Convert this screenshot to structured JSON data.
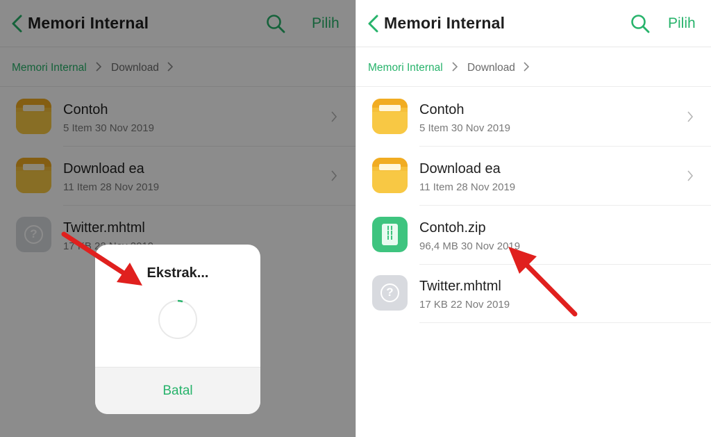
{
  "accent_color": "#27b36b",
  "left_panel": {
    "header": {
      "title": "Memori Internal",
      "action_label": "Pilih"
    },
    "breadcrumb": [
      "Memori Internal",
      "Download"
    ],
    "items": [
      {
        "name": "Contoh",
        "meta": "5 Item  30 Nov 2019",
        "icon": "folder-icon"
      },
      {
        "name": "Download ea",
        "meta": "11 Item  28 Nov 2019",
        "icon": "folder-icon"
      },
      {
        "name": "Twitter.mhtml",
        "meta": "17 KB  22 Nov 2019",
        "icon": "unknown-file-icon"
      }
    ],
    "dialog": {
      "title": "Ekstrak...",
      "cancel_label": "Batal"
    }
  },
  "right_panel": {
    "header": {
      "title": "Memori Internal",
      "action_label": "Pilih"
    },
    "breadcrumb": [
      "Memori Internal",
      "Download"
    ],
    "items": [
      {
        "name": "Contoh",
        "meta": "5 Item  30 Nov 2019",
        "icon": "folder-icon"
      },
      {
        "name": "Download ea",
        "meta": "11 Item  28 Nov 2019",
        "icon": "folder-icon"
      },
      {
        "name": "Contoh.zip",
        "meta": "96,4 MB  30 Nov 2019",
        "icon": "zip-file-icon"
      },
      {
        "name": "Twitter.mhtml",
        "meta": "17 KB  22 Nov 2019",
        "icon": "unknown-file-icon"
      }
    ]
  }
}
